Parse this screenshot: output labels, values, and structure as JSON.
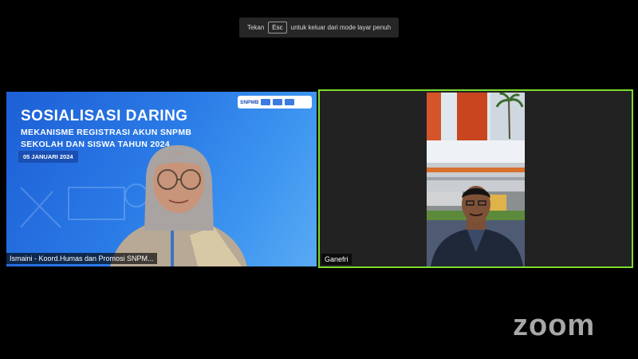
{
  "fullscreen_toast": {
    "prefix": "Tekan",
    "key": "Esc",
    "suffix": "untuk keluar dari mode layar penuh"
  },
  "left_tile": {
    "banner_title": "SOSIALISASI DARING",
    "banner_subtitle_1": "MEKANISME REGISTRASI AKUN SNPMB",
    "banner_subtitle_2": "SEKOLAH DAN SISWA TAHUN 2024",
    "date": "05 JANUARI 2024",
    "logo_text": "SNPMB",
    "participant_name": "Ismaini - Koord.Humas dan Promosi SNPM..."
  },
  "right_tile": {
    "participant_name": "Ganefri",
    "active_speaker_color": "#7ddc2c"
  },
  "brand": {
    "zoom_text": "zoom"
  }
}
